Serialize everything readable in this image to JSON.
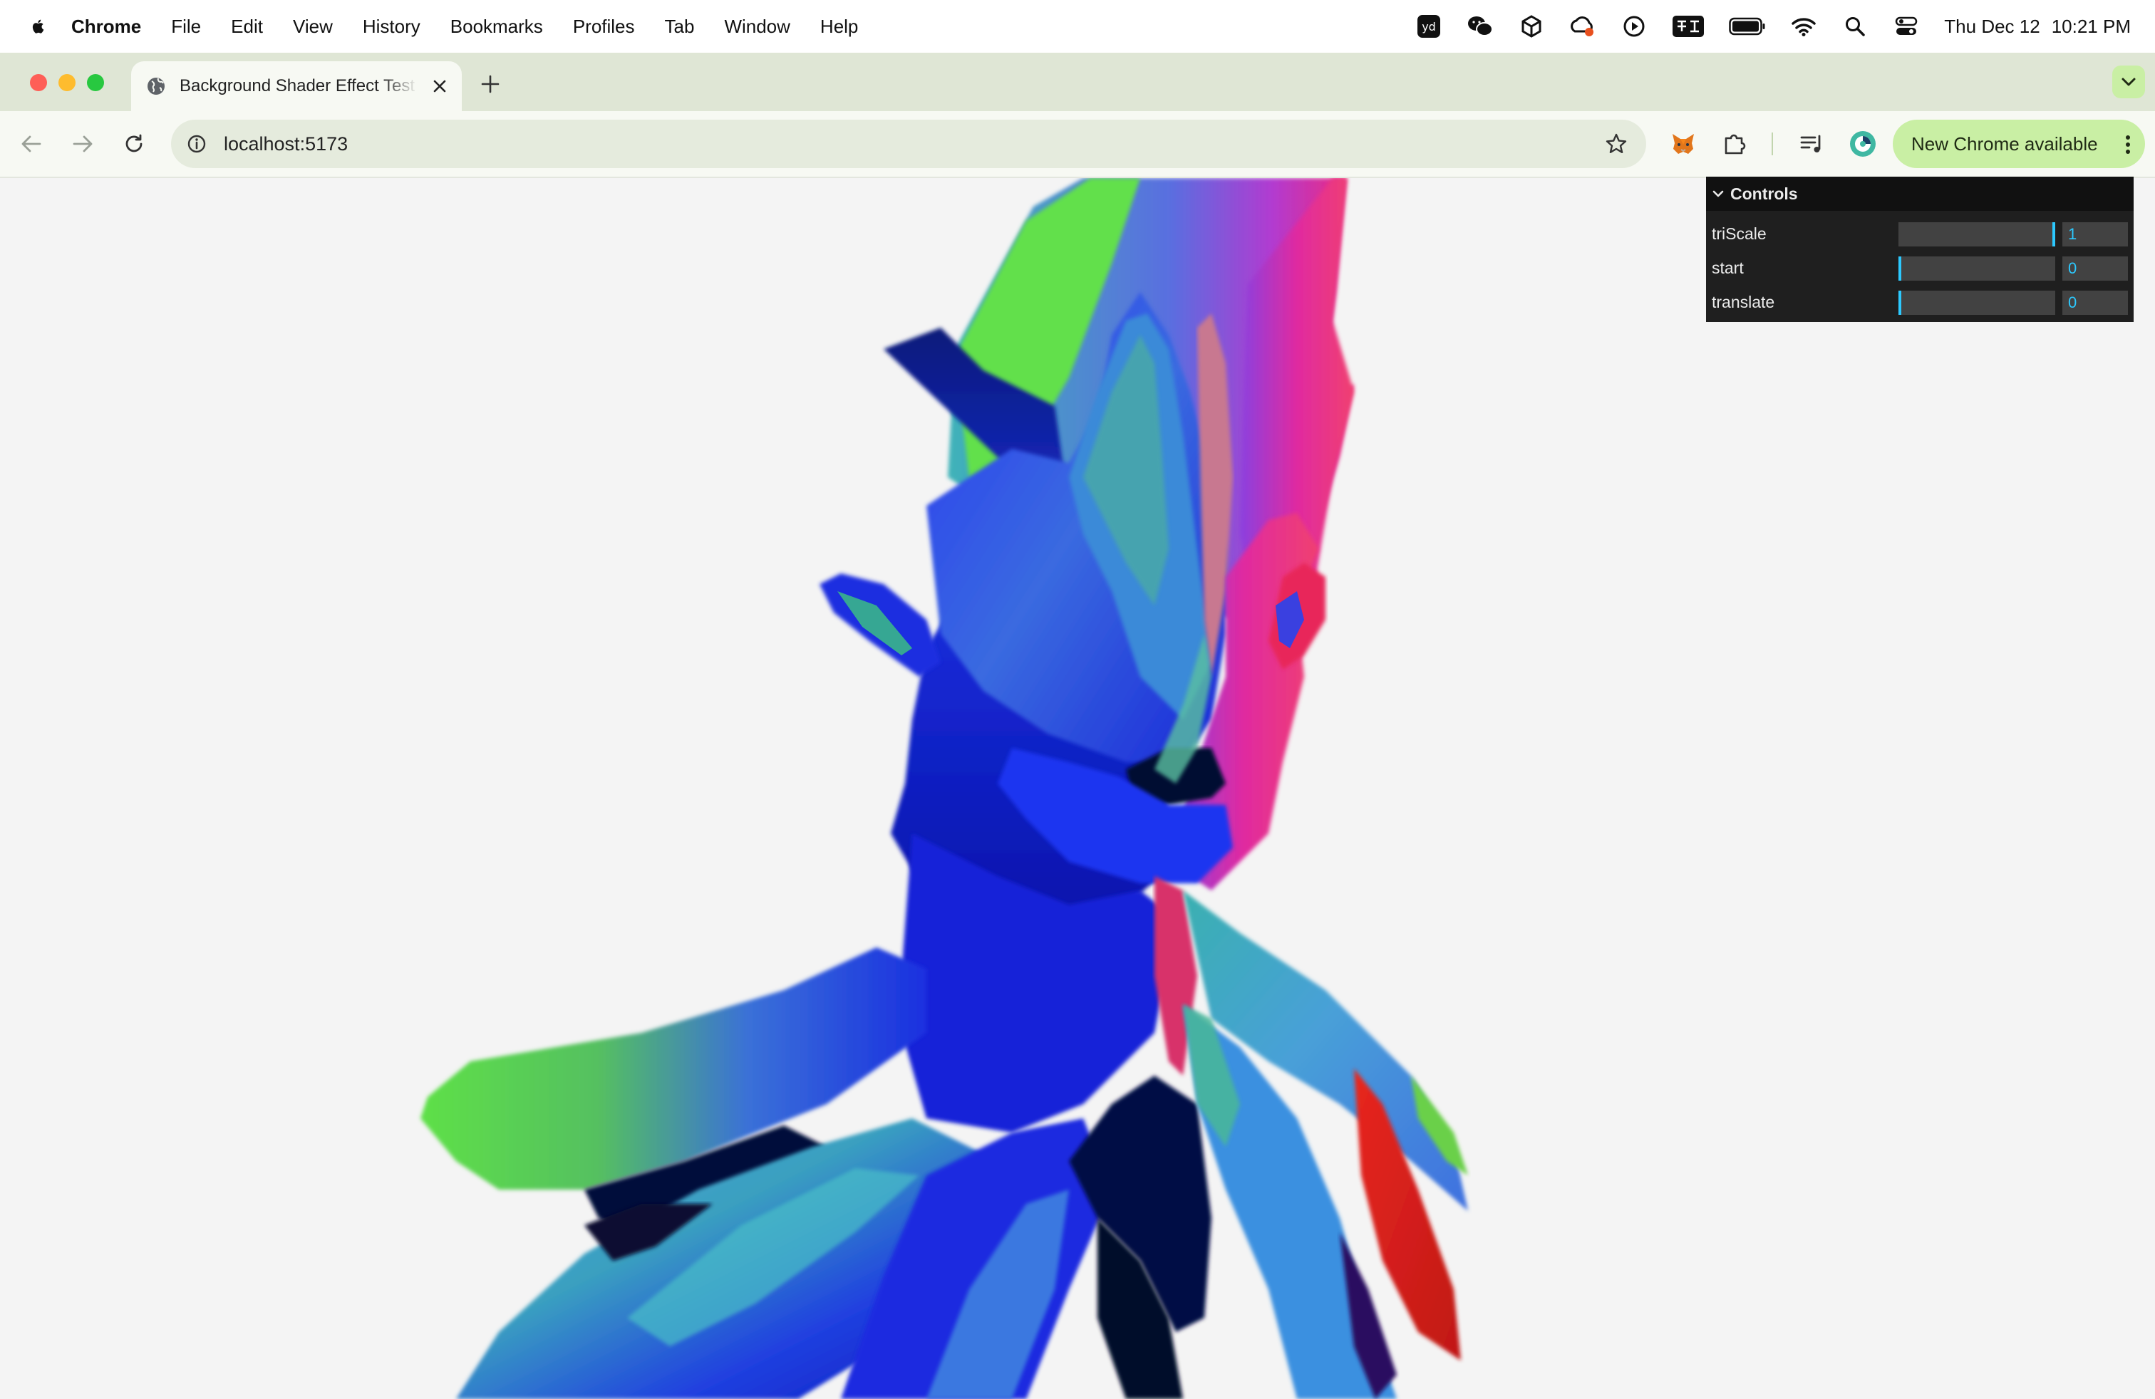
{
  "menubar": {
    "app_name": "Chrome",
    "items": [
      "File",
      "Edit",
      "View",
      "History",
      "Bookmarks",
      "Profiles",
      "Tab",
      "Window",
      "Help"
    ],
    "clock_day": "Thu Dec 12",
    "clock_time": "10:21 PM"
  },
  "tabs": {
    "active_title": "Background Shader Effect Test"
  },
  "toolbar": {
    "url": "localhost:5173",
    "update_label": "New Chrome available"
  },
  "controls": {
    "title": "Controls",
    "params": [
      {
        "name": "triScale",
        "value": "1",
        "fraction": 1.0
      },
      {
        "name": "start",
        "value": "0",
        "fraction": 0.0
      },
      {
        "name": "translate",
        "value": "0",
        "fraction": 0.0
      }
    ],
    "accent_color": "#2cc9ff"
  },
  "icons": {
    "menubar_tray": [
      "youdao-dict-icon",
      "wechat-icon",
      "unity-icon",
      "creative-cloud-icon",
      "play-circle-icon",
      "input-method-icon",
      "battery-icon",
      "wifi-icon",
      "spotlight-search-icon",
      "control-center-icon"
    ],
    "toolbar": [
      "metamask-fox-icon",
      "extensions-puzzle-icon",
      "reading-list-icon",
      "profile-avatar-icon"
    ]
  },
  "scene": {
    "description_colors": [
      "#1a1ad9",
      "#2e7bdc",
      "#66e04a",
      "#e01c8a",
      "#d9261c",
      "#050b3a"
    ]
  }
}
